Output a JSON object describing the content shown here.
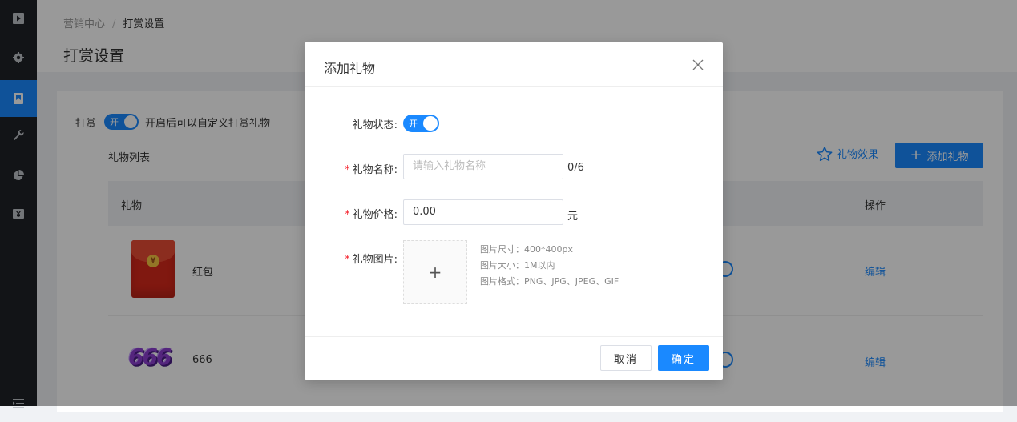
{
  "sidebar": {
    "items": [
      {
        "icon": "play-icon"
      },
      {
        "icon": "gear-icon"
      },
      {
        "icon": "bookmark-icon",
        "active": true
      },
      {
        "icon": "wrench-icon"
      },
      {
        "icon": "pie-chart-icon"
      },
      {
        "icon": "currency-icon"
      },
      {
        "icon": "menu-icon"
      }
    ]
  },
  "breadcrumb": {
    "parent": "营销中心",
    "separator": "/",
    "current": "打赏设置"
  },
  "page": {
    "title": "打赏设置"
  },
  "reward": {
    "label": "打赏",
    "switch_text": "开",
    "switch_on": true,
    "description": "开启后可以自定义打赏礼物"
  },
  "gift_list": {
    "title": "礼物列表",
    "effect_label": "礼物效果",
    "add_label": "添加礼物",
    "columns": {
      "gift": "礼物",
      "action": "操作"
    },
    "rows": [
      {
        "name": "红包",
        "image": "red-envelope",
        "edit_label": "编辑"
      },
      {
        "name": "666",
        "image": "666-badge",
        "image_text": "666",
        "edit_label": "编辑"
      }
    ]
  },
  "dialog": {
    "title": "添加礼物",
    "status_label": "礼物状态:",
    "status_switch_text": "开",
    "status_on": true,
    "name_label": "礼物名称:",
    "name_placeholder": "请输入礼物名称",
    "name_counter": "0/6",
    "price_label": "礼物价格:",
    "price_value": "0.00",
    "price_unit": "元",
    "image_label": "礼物图片:",
    "upload_plus": "+",
    "required_mark": "*",
    "tips": {
      "size": "图片尺寸：400*400px",
      "filesize": "图片大小：1M以内",
      "format": "图片格式：PNG、JPG、JPEG、GIF"
    },
    "cancel_label": "取消",
    "confirm_label": "确定"
  },
  "colors": {
    "accent": "#1a89ff",
    "sidebar_bg": "#1f2227",
    "required": "#f5222d"
  }
}
